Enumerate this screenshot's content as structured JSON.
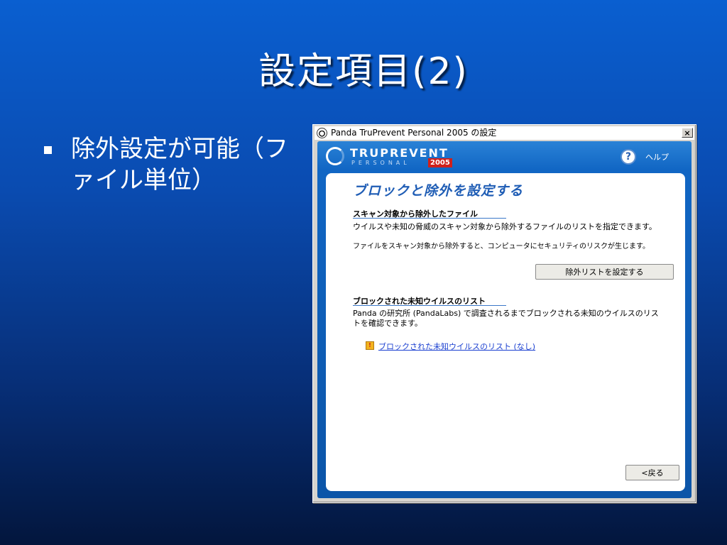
{
  "slide": {
    "title": "設定項目(2)",
    "bullet": "除外設定が可能（ファイル単位）"
  },
  "window": {
    "title": "Panda TruPrevent Personal 2005 の設定",
    "close_label": "×",
    "brand": {
      "name": "TRUPREVENT",
      "sub": "PERSONAL",
      "year": "2005"
    },
    "help_label": "ヘルプ",
    "panel_title": "ブロックと除外を設定する",
    "section1": {
      "heading": "スキャン対象から除外したファイル",
      "text1": "ウイルスや未知の脅威のスキャン対象から除外するファイルのリストを指定できます。",
      "text2": "ファイルをスキャン対象から除外すると、コンピュータにセキュリティのリスクが生じます。",
      "button": "除外リストを設定する"
    },
    "section2": {
      "heading": "ブロックされた未知ウイルスのリスト",
      "text": "Panda の研究所 (PandaLabs) で調査されるまでブロックされる未知のウイルスのリストを確認できます。",
      "link": "ブロックされた未知ウイルスのリスト (なし)"
    },
    "back_button": "<戻る"
  }
}
